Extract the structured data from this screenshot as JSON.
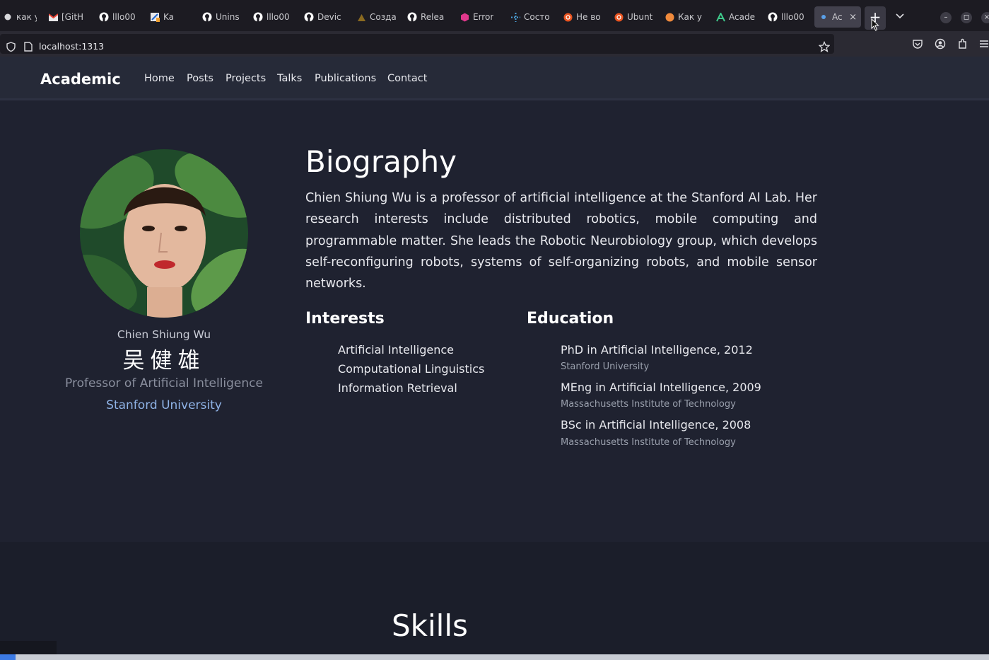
{
  "browser": {
    "tabs": [
      {
        "label": "как у",
        "icon": "generic-tab-icon"
      },
      {
        "label": "[GitH",
        "icon": "gmail-icon"
      },
      {
        "label": "lllo00",
        "icon": "github-icon"
      },
      {
        "label": "Ka",
        "icon": "edit-icon"
      },
      {
        "label": "Unins",
        "icon": "github-icon"
      },
      {
        "label": "lllo00",
        "icon": "github-icon"
      },
      {
        "label": "Devic",
        "icon": "github-icon"
      },
      {
        "label": "Созда",
        "icon": "generic-tab-icon"
      },
      {
        "label": "Relea",
        "icon": "github-icon"
      },
      {
        "label": "Error",
        "icon": "generic-tab-icon"
      },
      {
        "label": "Состо",
        "icon": "generic-tab-icon"
      },
      {
        "label": "Не во",
        "icon": "ubuntu-icon"
      },
      {
        "label": "Ubunt",
        "icon": "ubuntu-icon"
      },
      {
        "label": "Как у",
        "icon": "ubuntu-icon"
      },
      {
        "label": "Acade",
        "icon": "academic-icon"
      },
      {
        "label": "lllo00",
        "icon": "github-icon"
      }
    ],
    "active_tab": {
      "label": "Aca",
      "close": "×"
    },
    "new_tab": "+",
    "url": "localhost:1313"
  },
  "site": {
    "brand": "Academic",
    "nav": [
      "Home",
      "Posts",
      "Projects",
      "Talks",
      "Publications",
      "Contact"
    ]
  },
  "profile": {
    "name": "Chien Shiung Wu",
    "name_zh": "吴健雄",
    "role": "Professor of Artificial Intelligence",
    "organization": "Stanford University"
  },
  "biography": {
    "title": "Biography",
    "text": "Chien Shiung Wu is a professor of artificial intelligence at the Stanford AI Lab. Her research interests include distributed robotics, mobile computing and programmable matter. She leads the Robotic Neurobiology group, which develops self-reconfiguring robots, systems of self-organizing robots, and mobile sensor networks."
  },
  "interests": {
    "title": "Interests",
    "items": [
      "Artificial Intelligence",
      "Computational Linguistics",
      "Information Retrieval"
    ]
  },
  "education": {
    "title": "Education",
    "items": [
      {
        "course": "PhD in Artificial Intelligence, 2012",
        "institution": "Stanford University"
      },
      {
        "course": "MEng in Artificial Intelligence, 2009",
        "institution": "Massachusetts Institute of Technology"
      },
      {
        "course": "BSc in Artificial Intelligence, 2008",
        "institution": "Massachusetts Institute of Technology"
      }
    ]
  },
  "skills": {
    "title": "Skills"
  },
  "colors": {
    "page_bg": "#1f2230",
    "link_accent": "#8fb3e6",
    "tab_bar": "#1c1b22"
  }
}
